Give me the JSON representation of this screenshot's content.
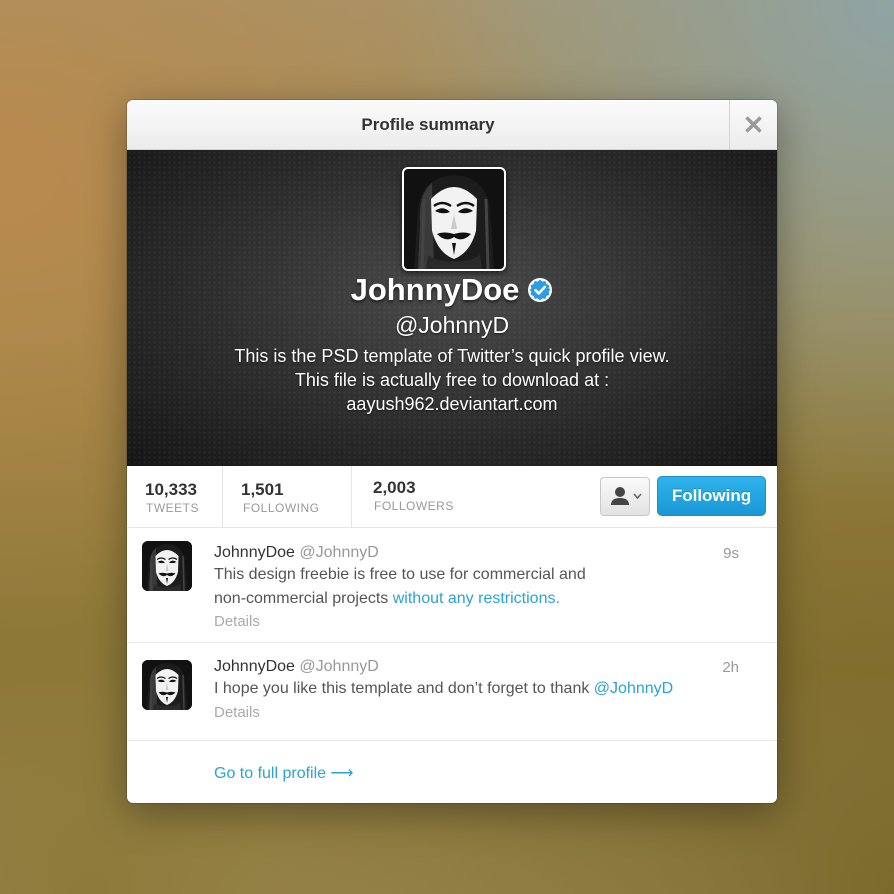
{
  "dialog": {
    "title": "Profile summary",
    "close_icon": "close-icon"
  },
  "profile": {
    "display_name": "JohnnyDoe",
    "handle": "@JohnnyD",
    "verified_icon": "verified-badge-icon",
    "bio": [
      "This is the PSD template of Twitter’s quick profile view.",
      "This file is actually free to download at :",
      "aayush962.deviantart.com"
    ]
  },
  "stats": {
    "tweets": {
      "value": "10,333",
      "label": "TWEETS"
    },
    "following": {
      "value": "1,501",
      "label": "FOLLOWING"
    },
    "followers": {
      "value": "2,003",
      "label": "FOLLOWERS"
    }
  },
  "actions": {
    "user_menu_icon": "user-dropdown-icon",
    "follow_label": "Following"
  },
  "tweets": [
    {
      "name": "JohnnyDoe",
      "username": "@JohnnyD",
      "time": "9s",
      "line1": "This design freebie is free to use for commercial and",
      "line2_text": "non-commercial projects ",
      "line2_link": "without any restrictions.",
      "details": "Details"
    },
    {
      "name": "JohnnyDoe",
      "username": "@JohnnyD",
      "time": "2h",
      "text": "I hope you like this template and don’t forget to thank ",
      "mention": "@JohnnyD",
      "details": "Details"
    }
  ],
  "footer": {
    "full_profile_label": "Go to full profile ⟶"
  },
  "colors": {
    "accent": "#2aa3d2",
    "follow_button": "#1a98d6"
  }
}
